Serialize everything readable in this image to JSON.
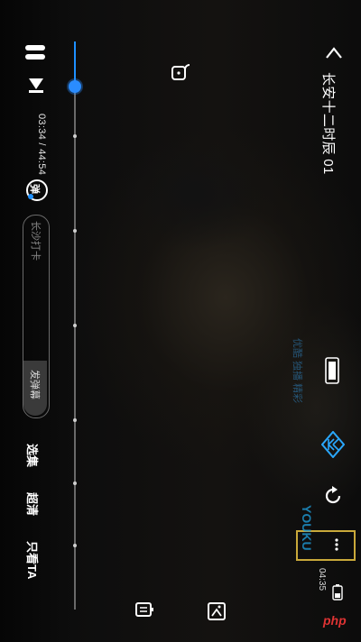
{
  "player": {
    "title": "长安十二时辰 01",
    "time": "03:34 / 44:54",
    "progress": 0.08,
    "chapter_dots": [
      0.166,
      0.333,
      0.5,
      0.666,
      0.777,
      0.888
    ]
  },
  "danmaku": {
    "toggle_label": "弹",
    "placeholder": "长沙打卡",
    "send_label": "发弹幕"
  },
  "menu": {
    "episodes": "选集",
    "quality": "超清",
    "only_ta": "只看TA"
  },
  "status": {
    "clock": "04:35"
  },
  "watermark": {
    "brand": "YOUKU",
    "sub": "优酷 独播 精彩"
  },
  "site_mark": "php",
  "colors": {
    "accent": "#1e90ff",
    "highlight_box": "#c9a93a"
  }
}
